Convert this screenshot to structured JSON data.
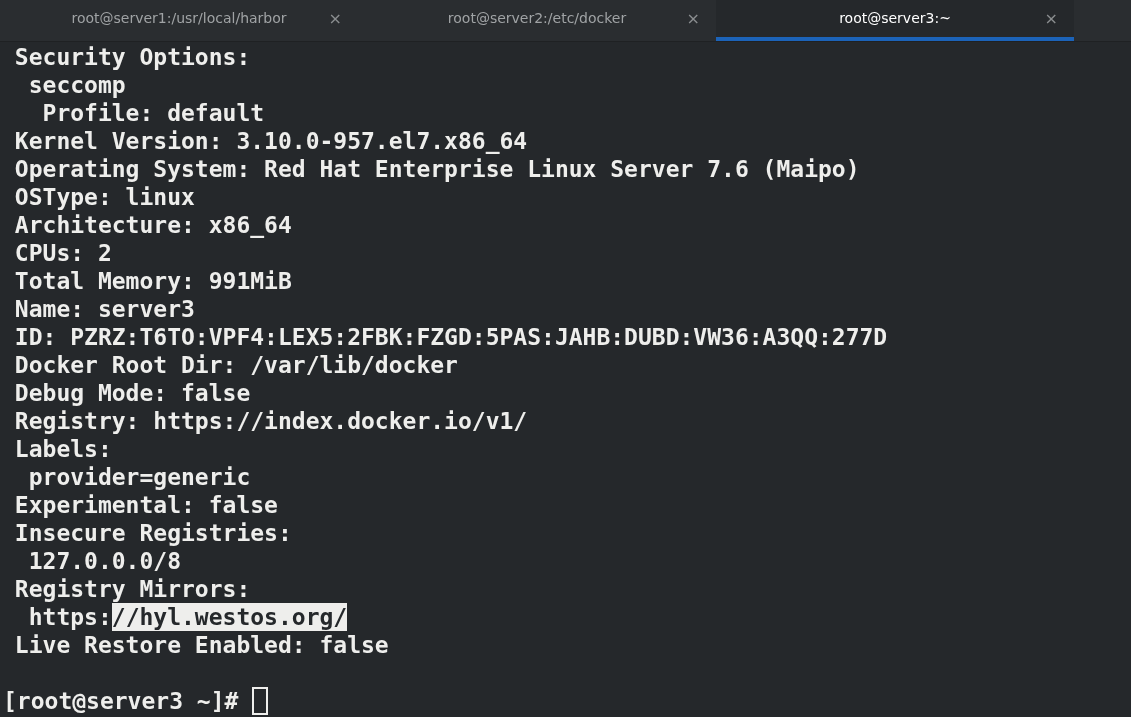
{
  "tabs": [
    {
      "title": "root@server1:/usr/local/harbor",
      "close": "×",
      "selected": false
    },
    {
      "title": "root@server2:/etc/docker",
      "close": "×",
      "selected": false
    },
    {
      "title": "root@server3:~",
      "close": "×",
      "selected": true
    }
  ],
  "terminal": {
    "lines": [
      {
        "parts": [
          {
            "text": " Security Options:",
            "selected": false
          }
        ]
      },
      {
        "parts": [
          {
            "text": "  seccomp",
            "selected": false
          }
        ]
      },
      {
        "parts": [
          {
            "text": "   Profile: default",
            "selected": false
          }
        ]
      },
      {
        "parts": [
          {
            "text": " Kernel Version: 3.10.0-957.el7.x86_64",
            "selected": false
          }
        ]
      },
      {
        "parts": [
          {
            "text": " Operating System: Red Hat Enterprise Linux Server 7.6 (Maipo)",
            "selected": false
          }
        ]
      },
      {
        "parts": [
          {
            "text": " OSType: linux",
            "selected": false
          }
        ]
      },
      {
        "parts": [
          {
            "text": " Architecture: x86_64",
            "selected": false
          }
        ]
      },
      {
        "parts": [
          {
            "text": " CPUs: 2",
            "selected": false
          }
        ]
      },
      {
        "parts": [
          {
            "text": " Total Memory: 991MiB",
            "selected": false
          }
        ]
      },
      {
        "parts": [
          {
            "text": " Name: server3",
            "selected": false
          }
        ]
      },
      {
        "parts": [
          {
            "text": " ID: PZRZ:T6TO:VPF4:LEX5:2FBK:FZGD:5PAS:JAHB:DUBD:VW36:A3QQ:277D",
            "selected": false
          }
        ]
      },
      {
        "parts": [
          {
            "text": " Docker Root Dir: /var/lib/docker",
            "selected": false
          }
        ]
      },
      {
        "parts": [
          {
            "text": " Debug Mode: false",
            "selected": false
          }
        ]
      },
      {
        "parts": [
          {
            "text": " Registry: https://index.docker.io/v1/",
            "selected": false
          }
        ]
      },
      {
        "parts": [
          {
            "text": " Labels:",
            "selected": false
          }
        ]
      },
      {
        "parts": [
          {
            "text": "  provider=generic",
            "selected": false
          }
        ]
      },
      {
        "parts": [
          {
            "text": " Experimental: false",
            "selected": false
          }
        ]
      },
      {
        "parts": [
          {
            "text": " Insecure Registries:",
            "selected": false
          }
        ]
      },
      {
        "parts": [
          {
            "text": "  127.0.0.0/8",
            "selected": false
          }
        ]
      },
      {
        "parts": [
          {
            "text": " Registry Mirrors:",
            "selected": false
          }
        ]
      },
      {
        "parts": [
          {
            "text": "  https:",
            "selected": false
          },
          {
            "text": "//hyl.westos.org/",
            "selected": true
          }
        ]
      },
      {
        "parts": [
          {
            "text": " Live Restore Enabled: false",
            "selected": false
          }
        ]
      }
    ],
    "prompt": "[root@server3 ~]#"
  }
}
